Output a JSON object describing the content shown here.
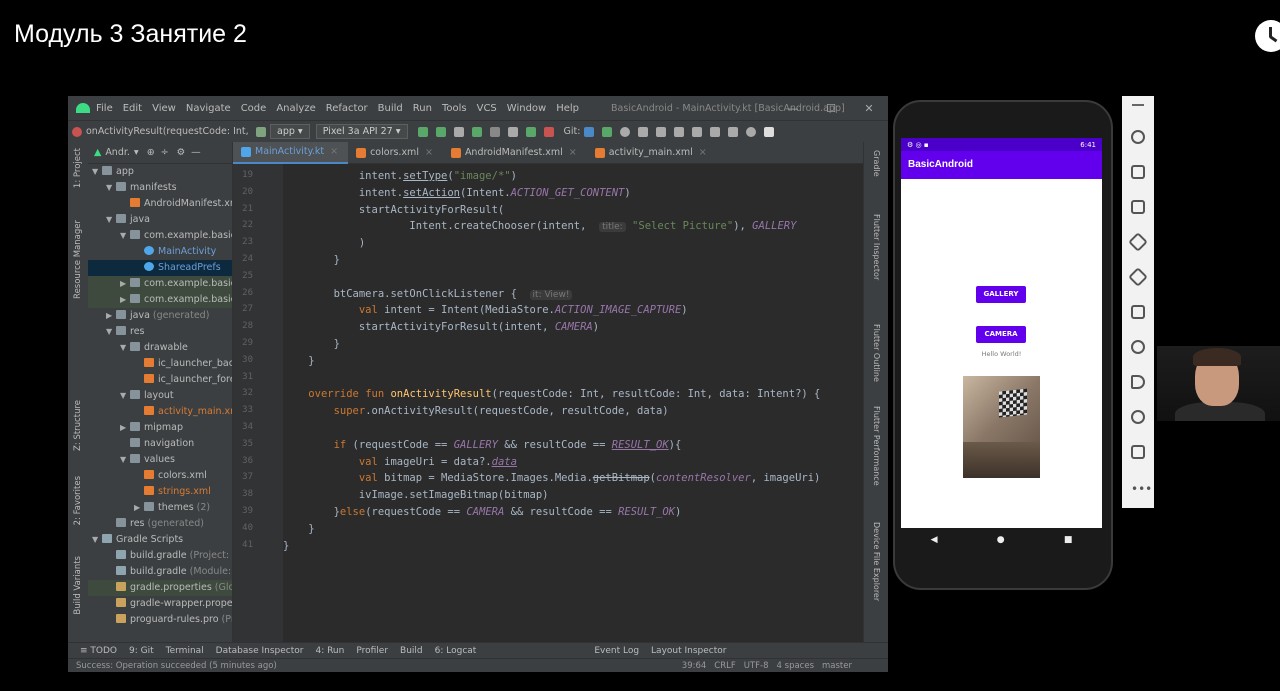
{
  "video_title": "Модуль 3 Занятие 2",
  "menubar": {
    "items": [
      "File",
      "Edit",
      "View",
      "Navigate",
      "Code",
      "Analyze",
      "Refactor",
      "Build",
      "Run",
      "Tools",
      "VCS",
      "Window",
      "Help"
    ],
    "window_title": "BasicAndroid - MainActivity.kt [BasicAndroid.app]"
  },
  "toolbar": {
    "breadcrumb": "onActivityResult(requestCode: Int, res",
    "module": "app",
    "device": "Pixel 3a API 27",
    "git_label": "Git:"
  },
  "project_panel": {
    "title": "Andr.",
    "tree": [
      {
        "label": "app",
        "indent": 0,
        "arrow": "▼",
        "icon": "folder"
      },
      {
        "label": "manifests",
        "indent": 1,
        "arrow": "▼",
        "icon": "folder"
      },
      {
        "label": "AndroidManifest.xm",
        "indent": 2,
        "arrow": "",
        "icon": "xml"
      },
      {
        "label": "java",
        "indent": 1,
        "arrow": "▼",
        "icon": "folder"
      },
      {
        "label": "com.example.basica",
        "indent": 2,
        "arrow": "▼",
        "icon": "folder"
      },
      {
        "label": "MainActivity",
        "indent": 3,
        "arrow": "",
        "icon": "kt",
        "cls": "blue"
      },
      {
        "label": "ShareadPrefs",
        "indent": 3,
        "arrow": "",
        "icon": "kt",
        "cls": "blue",
        "sel": true
      },
      {
        "label": "com.example.basica",
        "indent": 2,
        "arrow": "▶",
        "icon": "folder",
        "hl": true
      },
      {
        "label": "com.example.basica",
        "indent": 2,
        "arrow": "▶",
        "icon": "folder",
        "hl": true
      },
      {
        "label": "java",
        "suffix": " (generated)",
        "indent": 1,
        "arrow": "▶",
        "icon": "folder"
      },
      {
        "label": "res",
        "indent": 1,
        "arrow": "▼",
        "icon": "folder"
      },
      {
        "label": "drawable",
        "indent": 2,
        "arrow": "▼",
        "icon": "folder"
      },
      {
        "label": "ic_launcher_back",
        "indent": 3,
        "arrow": "",
        "icon": "xml"
      },
      {
        "label": "ic_launcher_fore",
        "indent": 3,
        "arrow": "",
        "icon": "xml"
      },
      {
        "label": "layout",
        "indent": 2,
        "arrow": "▼",
        "icon": "folder"
      },
      {
        "label": "activity_main.xm",
        "indent": 3,
        "arrow": "",
        "icon": "xml",
        "cls": "xmlc"
      },
      {
        "label": "mipmap",
        "indent": 2,
        "arrow": "▶",
        "icon": "folder"
      },
      {
        "label": "navigation",
        "indent": 2,
        "arrow": "",
        "icon": "folder"
      },
      {
        "label": "values",
        "indent": 2,
        "arrow": "▼",
        "icon": "folder"
      },
      {
        "label": "colors.xml",
        "indent": 3,
        "arrow": "",
        "icon": "xml"
      },
      {
        "label": "strings.xml",
        "indent": 3,
        "arrow": "",
        "icon": "xml",
        "cls": "xmlc"
      },
      {
        "label": "themes",
        "suffix": " (2)",
        "indent": 3,
        "arrow": "▶",
        "icon": "folder"
      },
      {
        "label": "res",
        "suffix": " (generated)",
        "indent": 1,
        "arrow": "",
        "icon": "folder"
      },
      {
        "label": "Gradle Scripts",
        "indent": 0,
        "arrow": "▼",
        "icon": "grad"
      },
      {
        "label": "build.gradle",
        "suffix": " (Project: Ba",
        "indent": 1,
        "arrow": "",
        "icon": "grad"
      },
      {
        "label": "build.gradle",
        "suffix": " (Module: B",
        "indent": 1,
        "arrow": "",
        "icon": "grad"
      },
      {
        "label": "gradle.properties",
        "suffix": " (Glob",
        "indent": 1,
        "arrow": "",
        "icon": "prop",
        "hl": true
      },
      {
        "label": "gradle-wrapper.properti",
        "indent": 1,
        "arrow": "",
        "icon": "prop"
      },
      {
        "label": "proguard-rules.pro",
        "suffix": " (Pro",
        "indent": 1,
        "arrow": "",
        "icon": "prop"
      }
    ]
  },
  "editor_tabs": [
    {
      "label": "MainActivity.kt",
      "active": true,
      "color": "#4fa6e8"
    },
    {
      "label": "colors.xml",
      "active": false,
      "color": "#e57c32"
    },
    {
      "label": "AndroidManifest.xml",
      "active": false,
      "color": "#e57c32"
    },
    {
      "label": "activity_main.xml",
      "active": false,
      "color": "#e57c32"
    }
  ],
  "code_lines": [
    {
      "n": "19",
      "html": "            intent.<span class='ul'>setType</span>(<span class='str'>\"image/*\"</span>)"
    },
    {
      "n": "20",
      "html": "            intent.<span class='ul'>setAction</span>(Intent.<span class='const'>ACTION_GET_CONTENT</span>)"
    },
    {
      "n": "21",
      "html": "            startActivityForResult("
    },
    {
      "n": "22",
      "html": "                    Intent.createChooser(intent,  <span class='hint'>title:</span> <span class='str'>\"Select Picture\"</span>), <span class='const'>GALLERY</span>"
    },
    {
      "n": "23",
      "html": "            )"
    },
    {
      "n": "24",
      "html": "        }"
    },
    {
      "n": "25",
      "html": ""
    },
    {
      "n": "26",
      "html": "        btCamera.setOnClickListener {  <span class='hint'>it: View!</span>"
    },
    {
      "n": "27",
      "html": "            <span class='kw'>val</span> intent = Intent(MediaStore.<span class='const'>ACTION_IMAGE_CAPTURE</span>)"
    },
    {
      "n": "28",
      "html": "            startActivityForResult(intent, <span class='const'>CAMERA</span>)"
    },
    {
      "n": "29",
      "html": "        }"
    },
    {
      "n": "30",
      "html": "    }"
    },
    {
      "n": "31",
      "html": ""
    },
    {
      "n": "32",
      "html": "    <span class='kw'>override fun</span> <span class='fn'>onActivityResult</span>(requestCode: Int, resultCode: Int, data: Intent?) {"
    },
    {
      "n": "33",
      "html": "        <span class='kw'>super</span>.onActivityResult(requestCode, resultCode, data)"
    },
    {
      "n": "34",
      "html": ""
    },
    {
      "n": "35",
      "html": "        <span class='kw'>if</span> (requestCode == <span class='const'>GALLERY</span> && resultCode == <span class='const ul'>RESULT_OK</span>){"
    },
    {
      "n": "36",
      "html": "            <span class='kw'>val</span> imageUri = data?.<span class='ital ul'>data</span>"
    },
    {
      "n": "37",
      "html": "            <span class='kw'>val</span> bitmap = MediaStore.Images.Media.<span class='strike'>getBitmap</span>(<span class='ital'>contentResolver</span>, imageUri)"
    },
    {
      "n": "38",
      "html": "            ivImage.setImageBitmap(bitmap)"
    },
    {
      "n": "39",
      "html": "        }<span class='kw'>else</span>(requestCode == <span class='const'>CAMERA</span> && resultCode == <span class='const'>RESULT_OK</span>)"
    },
    {
      "n": "40",
      "html": "    }"
    },
    {
      "n": "41",
      "html": "}"
    }
  ],
  "right_tools": [
    "Gradle",
    "Flutter Inspector",
    "Flutter Outline",
    "Flutter Performance",
    "Device File Explorer"
  ],
  "left_tools": [
    "1: Project",
    "Resource Manager",
    "Z: Structure",
    "2: Favorites",
    "Build Variants"
  ],
  "bottom_tools": [
    "≡ TODO",
    "9: Git",
    "Terminal",
    "Database Inspector",
    "4: Run",
    "Profiler",
    "Build",
    "6: Logcat",
    "Event Log",
    "Layout Inspector"
  ],
  "status": {
    "message": "Success: Operation succeeded (5 minutes ago)",
    "position": "39:64",
    "line_sep": "CRLF",
    "encoding": "UTF-8",
    "indent": "4 spaces",
    "branch": "master"
  },
  "phone": {
    "time": "6:41",
    "app_title": "BasicAndroid",
    "gallery_btn": "GALLERY",
    "camera_btn": "CAMERA",
    "hello": "Hello World!"
  }
}
